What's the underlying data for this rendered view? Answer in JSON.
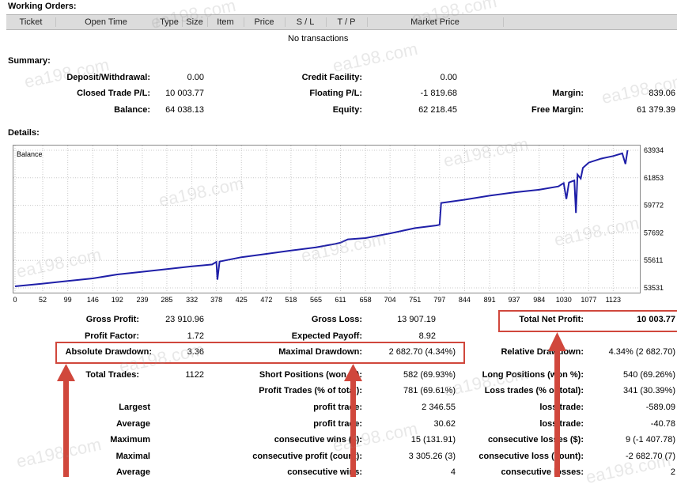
{
  "working_orders": {
    "title": "Working Orders:",
    "columns": [
      "Ticket",
      "Open Time",
      "Type",
      "Size",
      "Item",
      "Price",
      "S / L",
      "T / P",
      "Market Price"
    ],
    "empty_text": "No transactions"
  },
  "summary": {
    "title": "Summary:",
    "deposit_label": "Deposit/Withdrawal:",
    "deposit_value": "0.00",
    "closed_pl_label": "Closed Trade P/L:",
    "closed_pl_value": "10 003.77",
    "balance_label": "Balance:",
    "balance_value": "64 038.13",
    "credit_label": "Credit Facility:",
    "credit_value": "0.00",
    "floating_label": "Floating P/L:",
    "floating_value": "-1 819.68",
    "equity_label": "Equity:",
    "equity_value": "62 218.45",
    "margin_label": "Margin:",
    "margin_value": "839.06",
    "free_margin_label": "Free Margin:",
    "free_margin_value": "61 379.39"
  },
  "details": {
    "title": "Details:"
  },
  "chart_data": {
    "type": "line",
    "title": "Balance",
    "x_ticks": [
      "0",
      "52",
      "99",
      "146",
      "192",
      "239",
      "285",
      "332",
      "378",
      "425",
      "472",
      "518",
      "565",
      "611",
      "658",
      "704",
      "751",
      "797",
      "844",
      "891",
      "937",
      "984",
      "1030",
      "1077",
      "1123"
    ],
    "y_ticks": [
      "63934",
      "61853",
      "59772",
      "57692",
      "55611",
      "53531"
    ],
    "ylim": [
      53531,
      63934
    ],
    "xlim": [
      0,
      1170
    ],
    "color": "#1f1fa8",
    "points": [
      [
        0,
        53650
      ],
      [
        50,
        53850
      ],
      [
        99,
        54050
      ],
      [
        146,
        54250
      ],
      [
        192,
        54550
      ],
      [
        239,
        54750
      ],
      [
        285,
        54950
      ],
      [
        330,
        55150
      ],
      [
        370,
        55300
      ],
      [
        378,
        55500
      ],
      [
        380,
        54150
      ],
      [
        384,
        55520
      ],
      [
        425,
        55850
      ],
      [
        472,
        56100
      ],
      [
        518,
        56350
      ],
      [
        565,
        56600
      ],
      [
        600,
        56850
      ],
      [
        611,
        56950
      ],
      [
        625,
        57200
      ],
      [
        658,
        57300
      ],
      [
        704,
        57650
      ],
      [
        751,
        58050
      ],
      [
        790,
        58250
      ],
      [
        797,
        58300
      ],
      [
        800,
        59950
      ],
      [
        844,
        60200
      ],
      [
        891,
        60500
      ],
      [
        937,
        60750
      ],
      [
        984,
        60950
      ],
      [
        1020,
        61200
      ],
      [
        1030,
        61450
      ],
      [
        1035,
        60250
      ],
      [
        1040,
        61500
      ],
      [
        1050,
        61650
      ],
      [
        1053,
        59200
      ],
      [
        1056,
        62100
      ],
      [
        1062,
        61800
      ],
      [
        1066,
        62600
      ],
      [
        1077,
        63000
      ],
      [
        1100,
        63300
      ],
      [
        1123,
        63500
      ],
      [
        1140,
        63700
      ],
      [
        1146,
        62900
      ],
      [
        1150,
        63934
      ]
    ]
  },
  "stats": {
    "gross_profit_label": "Gross Profit:",
    "gross_profit_value": "23 910.96",
    "gross_loss_label": "Gross Loss:",
    "gross_loss_value": "13 907.19",
    "total_net_profit_label": "Total Net Profit:",
    "total_net_profit_value": "10 003.77",
    "profit_factor_label": "Profit Factor:",
    "profit_factor_value": "1.72",
    "expected_payoff_label": "Expected Payoff:",
    "expected_payoff_value": "8.92",
    "absolute_drawdown_label": "Absolute Drawdown:",
    "absolute_drawdown_value": "3.36",
    "maximal_drawdown_label": "Maximal Drawdown:",
    "maximal_drawdown_value": "2 682.70 (4.34%)",
    "relative_drawdown_label": "Relative Drawdown:",
    "relative_drawdown_value": "4.34% (2 682.70)",
    "total_trades_label": "Total Trades:",
    "total_trades_value": "1122",
    "short_positions_label": "Short Positions (won %):",
    "short_positions_value": "582 (69.93%)",
    "long_positions_label": "Long Positions (won %):",
    "long_positions_value": "540 (69.26%)",
    "profit_trades_label": "Profit Trades (% of total):",
    "profit_trades_value": "781 (69.61%)",
    "loss_trades_label": "Loss trades (% of total):",
    "loss_trades_value": "341 (30.39%)",
    "largest_label": "Largest",
    "largest_profit_label": "profit trade:",
    "largest_profit_value": "2 346.55",
    "largest_loss_label": "loss trade:",
    "largest_loss_value": "-589.09",
    "average_label": "Average",
    "average_profit_label": "profit trade:",
    "average_profit_value": "30.62",
    "average_loss_label": "loss trade:",
    "average_loss_value": "-40.78",
    "maximum_label": "Maximum",
    "max_cons_wins_label": "consecutive wins ($):",
    "max_cons_wins_value": "15 (131.91)",
    "max_cons_losses_label": "consecutive losses ($):",
    "max_cons_losses_value": "9 (-1 407.78)",
    "maximal_label": "Maximal",
    "maximal_cons_profit_label": "consecutive profit (count):",
    "maximal_cons_profit_value": "3 305.26 (3)",
    "maximal_cons_loss_label": "consecutive loss (count):",
    "maximal_cons_loss_value": "-2 682.70 (7)",
    "average2_label": "Average",
    "avg_cons_wins_label": "consecutive wins:",
    "avg_cons_wins_value": "4",
    "avg_cons_losses_label": "consecutive losses:",
    "avg_cons_losses_value": "2"
  },
  "watermark": "ea198.com"
}
